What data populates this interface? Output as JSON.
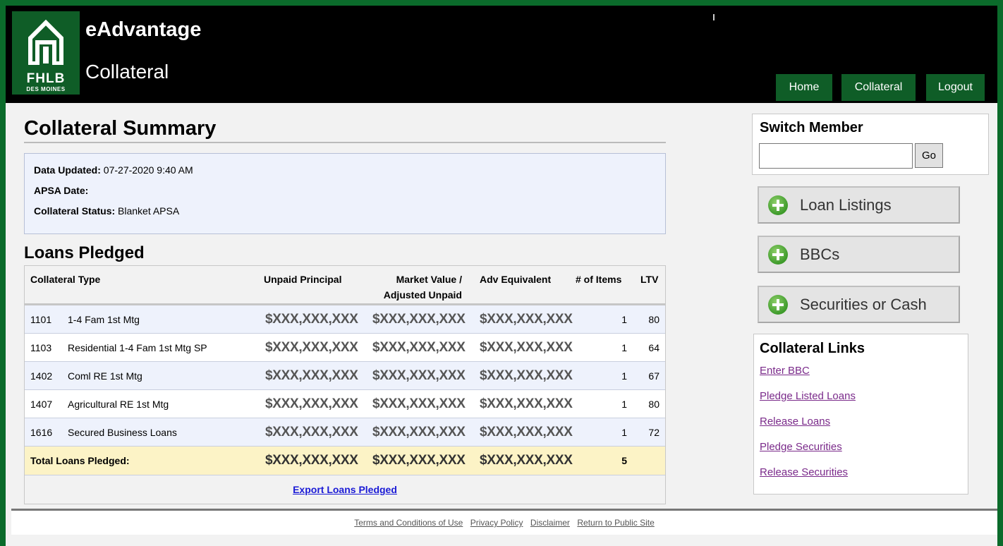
{
  "header": {
    "logo_text": "FHLB",
    "logo_subtext": "DES MOINES",
    "app_title": "eAdvantage",
    "app_subtitle": "Collateral",
    "nav": [
      {
        "label": "Home"
      },
      {
        "label": "Collateral"
      },
      {
        "label": "Logout"
      }
    ]
  },
  "main": {
    "title": "Collateral Summary",
    "info": {
      "data_updated_label": "Data Updated:",
      "data_updated_value": "07-27-2020 9:40 AM",
      "apsa_date_label": "APSA Date:",
      "apsa_date_value": "",
      "status_label": "Collateral Status:",
      "status_value": "Blanket APSA"
    },
    "loans_title": "Loans Pledged",
    "table": {
      "headers": {
        "type": "Collateral Type",
        "unpaid": "Unpaid Principal",
        "market_1": "Market Value /",
        "market_2": "Adjusted Unpaid",
        "adv": "Adv Equivalent",
        "items": "# of Items",
        "ltv": "LTV"
      },
      "rows": [
        {
          "code": "1101",
          "name": "1-4 Fam 1st Mtg",
          "unpaid": "$XXX,XXX,XXX",
          "market": "$XXX,XXX,XXX",
          "adv": "$XXX,XXX,XXX",
          "items": "1",
          "ltv": "80"
        },
        {
          "code": "1103",
          "name": "Residential 1-4 Fam 1st Mtg SP",
          "unpaid": "$XXX,XXX,XXX",
          "market": "$XXX,XXX,XXX",
          "adv": "$XXX,XXX,XXX",
          "items": "1",
          "ltv": "64"
        },
        {
          "code": "1402",
          "name": "Coml RE 1st Mtg",
          "unpaid": "$XXX,XXX,XXX",
          "market": "$XXX,XXX,XXX",
          "adv": "$XXX,XXX,XXX",
          "items": "1",
          "ltv": "67"
        },
        {
          "code": "1407",
          "name": "Agricultural RE 1st Mtg",
          "unpaid": "$XXX,XXX,XXX",
          "market": "$XXX,XXX,XXX",
          "adv": "$XXX,XXX,XXX",
          "items": "1",
          "ltv": "80"
        },
        {
          "code": "1616",
          "name": "Secured Business Loans",
          "unpaid": "$XXX,XXX,XXX",
          "market": "$XXX,XXX,XXX",
          "adv": "$XXX,XXX,XXX",
          "items": "1",
          "ltv": "72"
        }
      ],
      "total": {
        "label": "Total Loans Pledged:",
        "unpaid": "$XXX,XXX,XXX",
        "market": "$XXX,XXX,XXX",
        "adv": "$XXX,XXX,XXX",
        "items": "5"
      },
      "export_label": "Export Loans Pledged"
    }
  },
  "sidebar": {
    "switch_title": "Switch Member",
    "switch_input_value": "",
    "go_label": "Go",
    "buttons": [
      {
        "label": "Loan Listings"
      },
      {
        "label": "BBCs"
      },
      {
        "label": "Securities or Cash"
      }
    ],
    "links_title": "Collateral Links",
    "links": [
      {
        "label": "Enter BBC"
      },
      {
        "label": "Pledge Listed Loans"
      },
      {
        "label": "Release Loans"
      },
      {
        "label": "Pledge Securities"
      },
      {
        "label": "Release Securities"
      }
    ]
  },
  "footer": {
    "links": [
      {
        "label": "Terms and Conditions of Use"
      },
      {
        "label": "Privacy Policy"
      },
      {
        "label": "Disclaimer"
      },
      {
        "label": "Return to Public Site"
      }
    ]
  },
  "colors": {
    "brand_green": "#0f5d27",
    "frame_green": "#0b6b2b",
    "header_bg": "#000000",
    "total_row": "#fcf3c6",
    "alt_row": "#eef2fc",
    "link_purple": "#7a2a8a",
    "export_blue": "#1a1ad6"
  }
}
